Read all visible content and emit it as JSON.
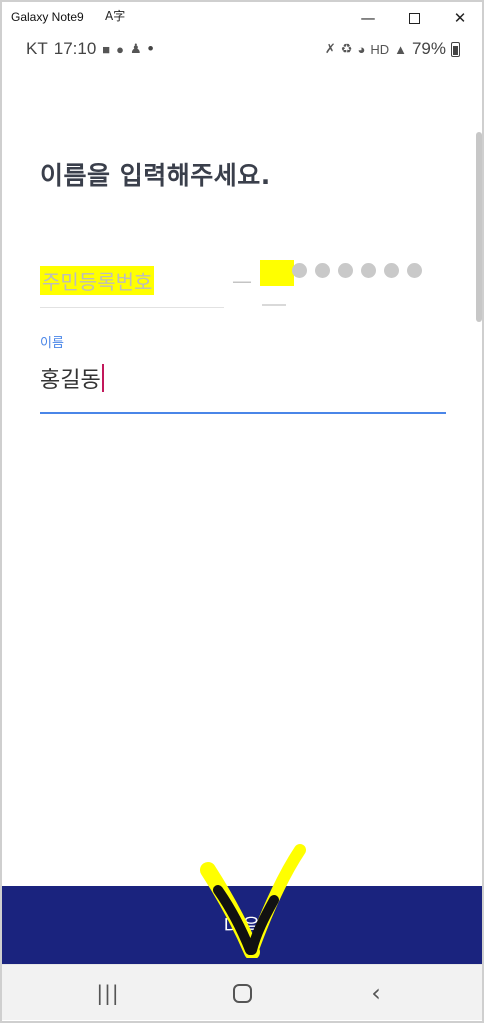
{
  "window": {
    "title": "Galaxy Note9",
    "lang_icon": "A字",
    "minimize": "—",
    "close": "✕"
  },
  "status_bar": {
    "carrier": "KT",
    "time": "17:10",
    "dot": "•",
    "battery": "79%",
    "notification_icons": [
      "calendar-icon",
      "talk-icon",
      "kakaotalk-icon",
      "person-icon"
    ],
    "system_icons": [
      "mute-icon",
      "sync-icon",
      "wifi-icon",
      "hd-icon",
      "signal-icon",
      "battery-icon"
    ]
  },
  "page": {
    "title": "이름을 입력해주세요."
  },
  "rrn": {
    "placeholder": "주민등록번호",
    "dash": "—",
    "masked_dot_count": 6,
    "highlight_color": "#ffff00"
  },
  "name_field": {
    "label": "이름",
    "value": "홍길동",
    "accent_color": "#4a86e8"
  },
  "next_button": {
    "label": "다음",
    "color": "#1a237e"
  },
  "nav_bar": {
    "recent": "|||",
    "back": "‹"
  }
}
